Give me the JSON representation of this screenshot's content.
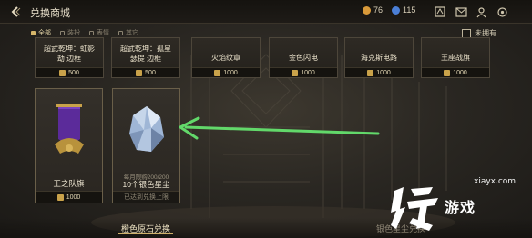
{
  "header": {
    "title": "兑换商城",
    "res1": "76",
    "res2": "115"
  },
  "filters": {
    "items": [
      "全部",
      "装扮",
      "表情",
      "其它"
    ],
    "owned_label": "未拥有"
  },
  "top_row": [
    {
      "name": "超武乾坤：虹影\n劫 边框",
      "price": "500"
    },
    {
      "name": "超武乾坤：孤星\n瑟提 边框",
      "price": "500"
    },
    {
      "name": "火焰纹章",
      "price": "1000"
    },
    {
      "name": "金色闪电",
      "price": "1000"
    },
    {
      "name": "海克斯电路",
      "price": "1000"
    },
    {
      "name": "王座战旗",
      "price": "1000"
    }
  ],
  "cards": [
    {
      "name": "王之队旗",
      "price": "1000"
    },
    {
      "name": "10个银色星尘",
      "limit": "每月限购200/200",
      "status": "已达到兑换上限"
    }
  ],
  "tabs": {
    "active": "橙色原石兑换",
    "inactive": "银色星尘兑换"
  },
  "watermark": {
    "url": "xiayx.com",
    "text": "游戏"
  },
  "colors": {
    "accent": "#d6b66a",
    "arrow": "#62d86a"
  }
}
